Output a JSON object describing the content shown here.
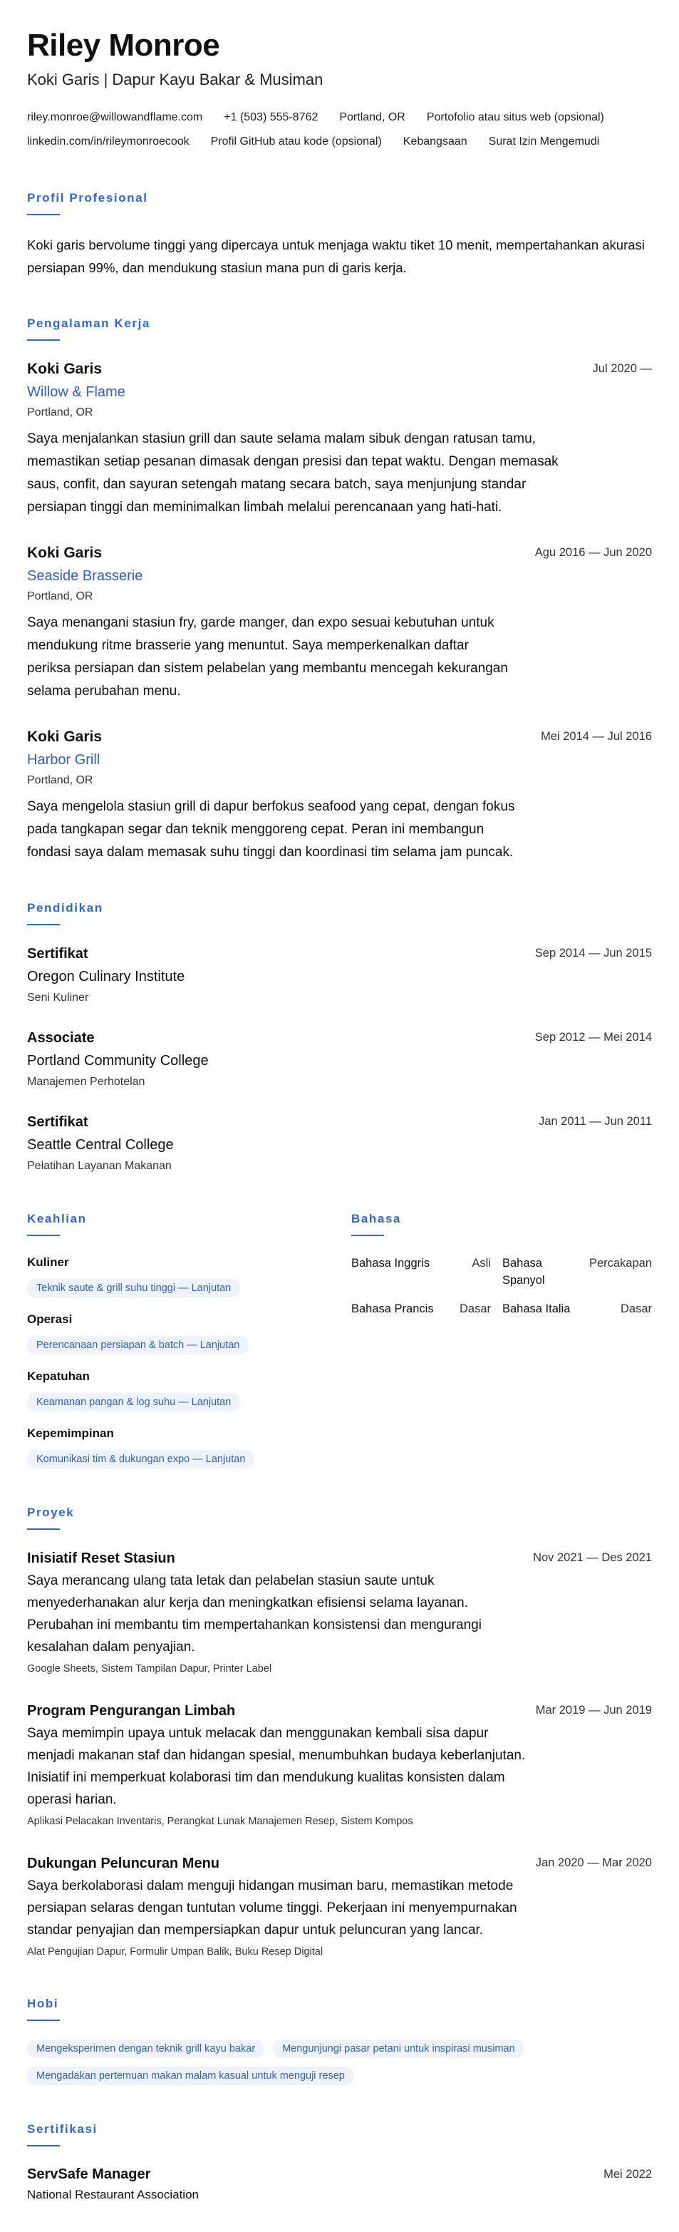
{
  "header": {
    "name": "Riley Monroe",
    "headline": "Koki Garis | Dapur Kayu Bakar & Musiman",
    "contacts": [
      "riley.monroe@willowandflame.com",
      "+1 (503) 555-8762",
      "Portland, OR",
      "Portofolio atau situs web (opsional)",
      "linkedin.com/in/rileymonroecook",
      "Profil GitHub atau kode (opsional)",
      "Kebangsaan",
      "Surat Izin Mengemudi"
    ]
  },
  "summary": {
    "title": "Profil Profesional",
    "text": "Koki garis bervolume tinggi yang dipercaya untuk menjaga waktu tiket 10 menit, mempertahankan akurasi persiapan 99%, dan mendukung stasiun mana pun di garis kerja."
  },
  "experience": {
    "title": "Pengalaman Kerja",
    "items": [
      {
        "role": "Koki Garis",
        "company": "Willow & Flame",
        "location": "Portland, OR",
        "date": "Jul 2020 —",
        "desc": "Saya menjalankan stasiun grill dan saute selama malam sibuk dengan ratusan tamu, memastikan setiap pesanan dimasak dengan presisi dan tepat waktu. Dengan memasak saus, confit, dan sayuran setengah matang secara batch, saya menjunjung standar persiapan tinggi dan meminimalkan limbah melalui perencanaan yang hati-hati."
      },
      {
        "role": "Koki Garis",
        "company": "Seaside Brasserie",
        "location": "Portland, OR",
        "date": "Agu 2016 — Jun 2020",
        "desc": "Saya menangani stasiun fry, garde manger, dan expo sesuai kebutuhan untuk mendukung ritme brasserie yang menuntut. Saya memperkenalkan daftar periksa persiapan dan sistem pelabelan yang membantu mencegah kekurangan selama perubahan menu."
      },
      {
        "role": "Koki Garis",
        "company": "Harbor Grill",
        "location": "Portland, OR",
        "date": "Mei 2014 — Jul 2016",
        "desc": "Saya mengelola stasiun grill di dapur berfokus seafood yang cepat, dengan fokus pada tangkapan segar dan teknik menggoreng cepat. Peran ini membangun fondasi saya dalam memasak suhu tinggi dan koordinasi tim selama jam puncak."
      }
    ]
  },
  "education": {
    "title": "Pendidikan",
    "items": [
      {
        "degree": "Sertifikat",
        "school": "Oregon Culinary Institute",
        "field": "Seni Kuliner",
        "date": "Sep 2014 — Jun 2015"
      },
      {
        "degree": "Associate",
        "school": "Portland Community College",
        "field": "Manajemen Perhotelan",
        "date": "Sep 2012 — Mei 2014"
      },
      {
        "degree": "Sertifikat",
        "school": "Seattle Central College",
        "field": "Pelatihan Layanan Makanan",
        "date": "Jan 2011 — Jun 2011"
      }
    ]
  },
  "skills": {
    "title": "Keahlian",
    "groups": [
      {
        "name": "Kuliner",
        "pill": "Teknik saute & grill suhu tinggi — Lanjutan"
      },
      {
        "name": "Operasi",
        "pill": "Perencanaan persiapan & batch — Lanjutan"
      },
      {
        "name": "Kepatuhan",
        "pill": "Keamanan pangan & log suhu — Lanjutan"
      },
      {
        "name": "Kepemimpinan",
        "pill": "Komunikasi tim & dukungan expo — Lanjutan"
      }
    ]
  },
  "languages": {
    "title": "Bahasa",
    "items": [
      {
        "name": "Bahasa Inggris",
        "level": "Asli"
      },
      {
        "name": "Bahasa Spanyol",
        "level": "Percakapan"
      },
      {
        "name": "Bahasa Prancis",
        "level": "Dasar"
      },
      {
        "name": "Bahasa Italia",
        "level": "Dasar"
      }
    ]
  },
  "projects": {
    "title": "Proyek",
    "items": [
      {
        "name": "Inisiatif Reset Stasiun",
        "date": "Nov 2021 — Des 2021",
        "desc": "Saya merancang ulang tata letak dan pelabelan stasiun saute untuk menyederhanakan alur kerja dan meningkatkan efisiensi selama layanan. Perubahan ini membantu tim mempertahankan konsistensi dan mengurangi kesalahan dalam penyajian.",
        "tech": "Google Sheets, Sistem Tampilan Dapur, Printer Label"
      },
      {
        "name": "Program Pengurangan Limbah",
        "date": "Mar 2019 — Jun 2019",
        "desc": "Saya memimpin upaya untuk melacak dan menggunakan kembali sisa dapur menjadi makanan staf dan hidangan spesial, menumbuhkan budaya keberlanjutan. Inisiatif ini memperkuat kolaborasi tim dan mendukung kualitas konsisten dalam operasi harian.",
        "tech": "Aplikasi Pelacakan Inventaris, Perangkat Lunak Manajemen Resep, Sistem Kompos"
      },
      {
        "name": "Dukungan Peluncuran Menu",
        "date": "Jan 2020 — Mar 2020",
        "desc": "Saya berkolaborasi dalam menguji hidangan musiman baru, memastikan metode persiapan selaras dengan tuntutan volume tinggi. Pekerjaan ini menyempurnakan standar penyajian dan mempersiapkan dapur untuk peluncuran yang lancar.",
        "tech": "Alat Pengujian Dapur, Formulir Umpan Balik, Buku Resep Digital"
      }
    ]
  },
  "hobbies": {
    "title": "Hobi",
    "items": [
      "Mengeksperimen dengan teknik grill kayu bakar",
      "Mengunjungi pasar petani untuk inspirasi musiman",
      "Mengadakan pertemuan makan malam kasual untuk menguji resep"
    ]
  },
  "certifications": {
    "title": "Sertifikasi",
    "items": [
      {
        "name": "ServSafe Manager",
        "issuer": "National Restaurant Association",
        "date": "Mei 2022"
      }
    ]
  }
}
